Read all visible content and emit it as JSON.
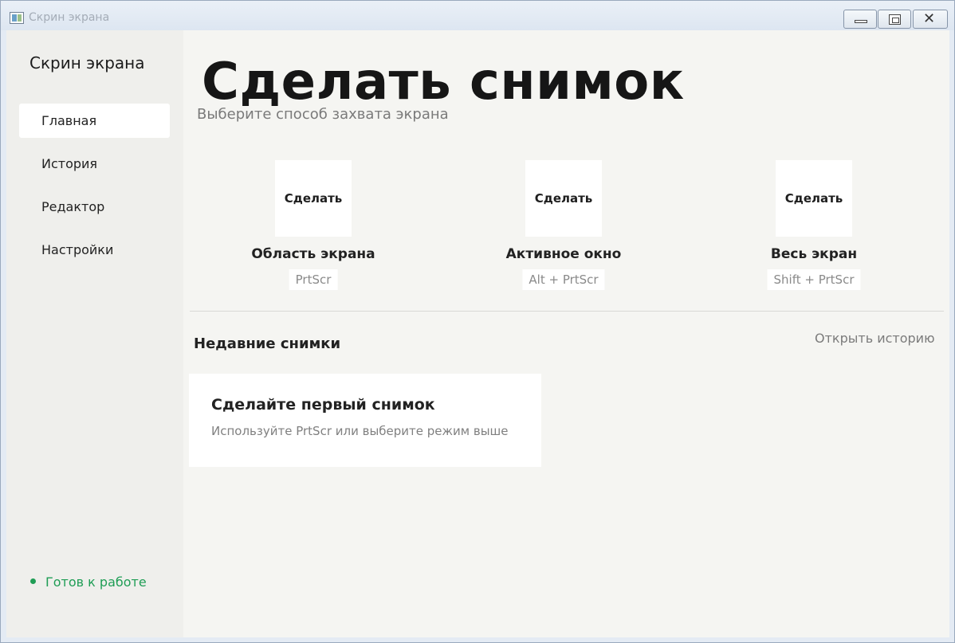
{
  "window": {
    "title": "Скрин экрана"
  },
  "sidebar": {
    "app_name": "Скрин экрана",
    "items": [
      {
        "label": "Главная",
        "active": true
      },
      {
        "label": "История",
        "active": false
      },
      {
        "label": "Редактор",
        "active": false
      },
      {
        "label": "Настройки",
        "active": false
      }
    ],
    "status": "Готов к работе"
  },
  "main": {
    "title": "Сделать снимок",
    "subtitle": "Выберите способ захвата экрана",
    "modes": [
      {
        "button": "Сделать",
        "label": "Область экрана",
        "hotkey": "PrtScr"
      },
      {
        "button": "Сделать",
        "label": "Активное окно",
        "hotkey": "Alt + PrtScr"
      },
      {
        "button": "Сделать",
        "label": "Весь экран",
        "hotkey": "Shift + PrtScr"
      }
    ],
    "recent": {
      "title": "Недавние снимки",
      "open_history": "Открыть историю",
      "empty_title": "Сделайте первый снимок",
      "empty_desc": "Используйте PrtScr или выберите режим выше"
    }
  },
  "colors": {
    "status_green": "#1f9d55",
    "background": "#f5f5f2"
  }
}
